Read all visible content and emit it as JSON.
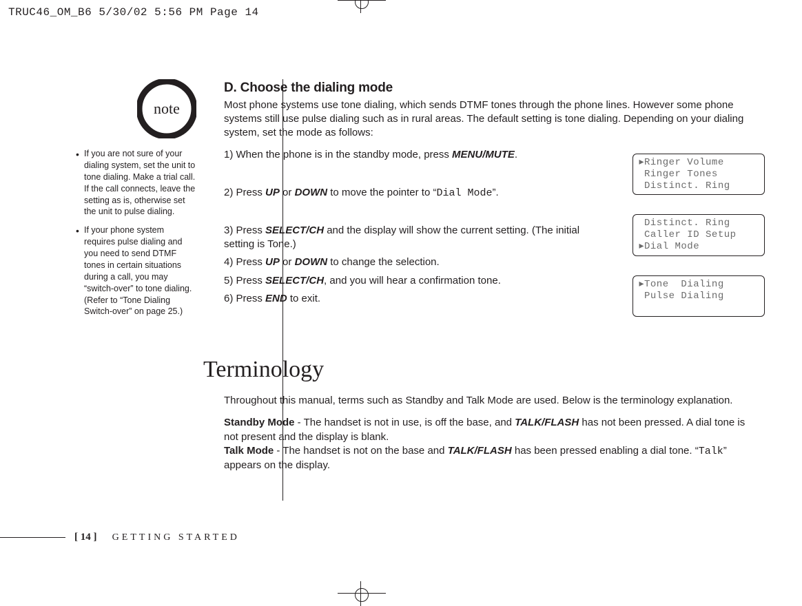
{
  "prepress": {
    "slug": "TRUC46_OM_B6  5/30/02  5:56 PM  Page 14"
  },
  "noteIcon": {
    "label": "note"
  },
  "notes": {
    "items": [
      "If you are not sure of your dialing system, set the unit to tone dialing. Make a trial call. If the call connects, leave the setting as is, otherwise set the unit to pulse dialing.",
      "If your phone system requires pulse dialing and you need to send DTMF tones in certain situations during a call, you may “switch-over” to tone dialing. (Refer to “Tone Dialing Switch-over” on page 25.)"
    ]
  },
  "sectionD": {
    "title": "D. Choose the dialing mode",
    "intro": "Most phone systems use tone dialing, which sends DTMF tones through the phone lines. However some phone systems still use pulse dialing such as in rural areas. The default setting is tone dialing. Depending on your dialing system, set the mode as follows:",
    "steps": [
      {
        "n": "1)",
        "pre": "When the phone is in the standby mode, press ",
        "kw": "MENU/MUTE",
        "post": "."
      },
      {
        "n": "2)",
        "pre": "Press ",
        "kw": "UP",
        "mid": " or ",
        "kw2": "DOWN",
        "post": " to move the pointer to “",
        "mono": "Dial Mode",
        "close": "”."
      },
      {
        "n": "3)",
        "pre": "Press ",
        "kw": "SELECT/CH",
        "post": " and the display will show the current setting. (The initial setting is Tone.)"
      },
      {
        "n": "4)",
        "pre": "Press ",
        "kw": "UP",
        "mid": " or ",
        "kw2": "DOWN",
        "post": " to change the selection."
      },
      {
        "n": "5)",
        "pre": "Press ",
        "kw": "SELECT/CH",
        "post": ", and you will hear a confirmation tone."
      },
      {
        "n": "6)",
        "pre": "Press ",
        "kw": "END",
        "post": " to exit."
      }
    ]
  },
  "lcd": {
    "screens": [
      {
        "lines": [
          {
            "ptr": "▸",
            "text": "Ringer Volume"
          },
          {
            "ptr": " ",
            "text": "Ringer Tones"
          },
          {
            "ptr": " ",
            "text": "Distinct. Ring"
          }
        ]
      },
      {
        "lines": [
          {
            "ptr": " ",
            "text": "Distinct. Ring"
          },
          {
            "ptr": " ",
            "text": "Caller ID Setup"
          },
          {
            "ptr": "▸",
            "text": "Dial Mode"
          }
        ]
      },
      {
        "lines": [
          {
            "ptr": "▸",
            "text": "Tone  Dialing"
          },
          {
            "ptr": " ",
            "text": "Pulse Dialing"
          },
          {
            "ptr": " ",
            "text": ""
          }
        ]
      }
    ]
  },
  "terminology": {
    "heading": "Terminology",
    "intro": "Throughout this manual, terms such as Standby and Talk Mode are used. Below is the terminology explanation.",
    "standby_label": "Standby Mode",
    "standby_text_a": " - The handset is not in use, is off the base, and ",
    "standby_kw": "TALK/FLASH",
    "standby_text_b": " has not been pressed. A dial tone is not present and the display is blank.",
    "talk_label": "Talk Mode",
    "talk_text_a": " - The handset is not on the base and ",
    "talk_kw": "TALK/FLASH",
    "talk_text_b": " has been pressed enabling a dial tone. “",
    "talk_mono": "Talk",
    "talk_text_c": "” appears on the display."
  },
  "footer": {
    "page": "[ 14 ]",
    "section": "GETTING STARTED"
  }
}
